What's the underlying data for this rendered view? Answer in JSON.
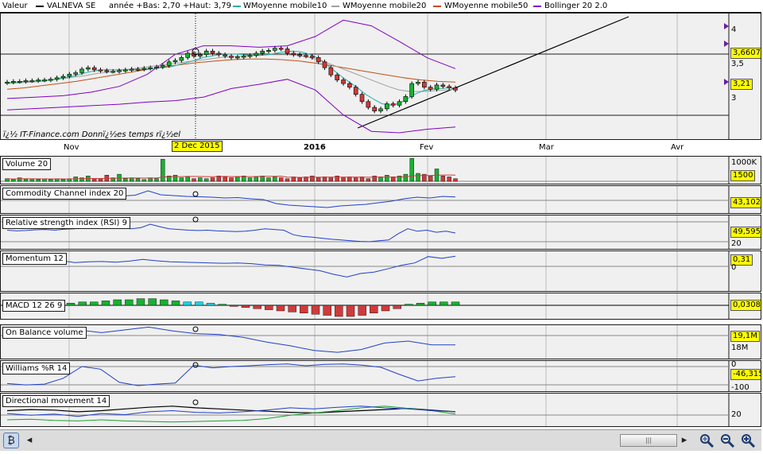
{
  "legend": {
    "valeur_label": "Valeur",
    "stock_name": "VALNEVA SE",
    "range_text": "année +Bas: 2,70 +Haut: 3,79",
    "ma10_label": "WMoyenne mobile10",
    "ma20_label": "WMoyenne mobile20",
    "ma50_label": "WMoyenne mobile50",
    "bollinger_label": "Bollinger 20 2.0",
    "colors": {
      "stock": "#000000",
      "ma10": "#20b2aa",
      "ma20": "#a0a0a0",
      "ma50": "#c0501a",
      "bollinger": "#8000c0"
    }
  },
  "main_chart": {
    "watermark": "ï¿½ IT-Finance.com  Donnï¿½es temps rï¿½el",
    "price_ticks": [
      "4",
      "3,5",
      "3"
    ],
    "last_price_box": "3,6607",
    "current_box": "3,21",
    "colors": {
      "up": "#19b032",
      "down": "#d03a3a",
      "ma10": "#20b2aa",
      "ma20": "#a0a0a0",
      "ma50": "#c0501a",
      "bollinger": "#8000c0"
    }
  },
  "time_axis": {
    "labels": [
      "Nov",
      "2016",
      "Fev",
      "Mar",
      "Avr"
    ],
    "cursor_date": "2 Dec 2015"
  },
  "indicators": {
    "volume": {
      "label": "Volume 20",
      "tick": "1000K",
      "value": "1500"
    },
    "cci": {
      "label": "Commodity Channel index 20",
      "value": "43,1022"
    },
    "rsi": {
      "label": "Relative strength index (RSI) 9",
      "value": "49,595",
      "tick": "20"
    },
    "momentum": {
      "label": "Momentum 12",
      "value": "0,31",
      "tick": "0"
    },
    "macd": {
      "label": "MACD 12 26 9",
      "value": "0,0308"
    },
    "obv": {
      "label": "On Balance volume",
      "value": "19,1M",
      "tick": "18M"
    },
    "williams": {
      "label": "Williams %R 14",
      "tick_top": "0",
      "value": "-46,315",
      "tick_bottom": "-100"
    },
    "dmi": {
      "label": "Directional movement 14",
      "tick": "20"
    }
  },
  "chart_data": {
    "type": "line",
    "title": "",
    "series": [
      {
        "name": "VALNEVA SE",
        "values": [
          3.32,
          3.33,
          3.33,
          3.34,
          3.34,
          3.35,
          3.35,
          3.36,
          3.38,
          3.4,
          3.43,
          3.45,
          3.5,
          3.52,
          3.49,
          3.48,
          3.47,
          3.47,
          3.48,
          3.49,
          3.5,
          3.5,
          3.51,
          3.52,
          3.53,
          3.55,
          3.6,
          3.62,
          3.66,
          3.72,
          3.68,
          3.7,
          3.75,
          3.72,
          3.7,
          3.68,
          3.66,
          3.67,
          3.68,
          3.69,
          3.72,
          3.75,
          3.76,
          3.79,
          3.78,
          3.72,
          3.7,
          3.69,
          3.68,
          3.66,
          3.6,
          3.52,
          3.42,
          3.35,
          3.3,
          3.25,
          3.15,
          3.05,
          2.97,
          2.92,
          2.95,
          3.02,
          3.0,
          3.05,
          3.12,
          3.3,
          3.32,
          3.25,
          3.22,
          3.28,
          3.26,
          3.24,
          3.21
        ]
      },
      {
        "name": "WMoyenne mobile10",
        "values": [
          3.31,
          3.32,
          3.33,
          3.33,
          3.34,
          3.35,
          3.36,
          3.38,
          3.4,
          3.43,
          3.46,
          3.48,
          3.49,
          3.49,
          3.49,
          3.49,
          3.49,
          3.5,
          3.51,
          3.52,
          3.53,
          3.56,
          3.59,
          3.62,
          3.66,
          3.68,
          3.7,
          3.71,
          3.71,
          3.7,
          3.69,
          3.69,
          3.7,
          3.72,
          3.74,
          3.75,
          3.74,
          3.71,
          3.66,
          3.58,
          3.49,
          3.4,
          3.32,
          3.24,
          3.15,
          3.08,
          3.02,
          3.0,
          3.02,
          3.08,
          3.15,
          3.2,
          3.22,
          3.23,
          3.24,
          3.24
        ]
      },
      {
        "name": "WMoyenne mobile20",
        "values": [
          3.3,
          3.31,
          3.32,
          3.33,
          3.35,
          3.37,
          3.39,
          3.41,
          3.44,
          3.46,
          3.48,
          3.5,
          3.52,
          3.54,
          3.56,
          3.58,
          3.6,
          3.62,
          3.64,
          3.66,
          3.67,
          3.68,
          3.69,
          3.7,
          3.7,
          3.7,
          3.69,
          3.66,
          3.62,
          3.56,
          3.5,
          3.44,
          3.38,
          3.32,
          3.26,
          3.21,
          3.19,
          3.19,
          3.2,
          3.21,
          3.22
        ]
      },
      {
        "name": "WMoyenne mobile50",
        "values": [
          3.22,
          3.24,
          3.27,
          3.3,
          3.33,
          3.37,
          3.41,
          3.45,
          3.49,
          3.53,
          3.56,
          3.59,
          3.61,
          3.63,
          3.64,
          3.64,
          3.63,
          3.61,
          3.58,
          3.54,
          3.5,
          3.46,
          3.42,
          3.38,
          3.35,
          3.33,
          3.32
        ]
      },
      {
        "name": "Bollinger 20 2.0",
        "values": [
          3.18,
          3.2,
          3.22,
          3.27,
          3.35,
          3.52,
          3.8,
          3.92,
          3.92,
          3.9,
          3.92,
          4.05,
          4.28,
          4.2,
          3.98,
          3.75,
          3.6
        ]
      },
      {
        "name": "Volume 20",
        "values": [
          0.3,
          0.2,
          0.4,
          0.2,
          0.3,
          0.2,
          0.3,
          0.2,
          0.3,
          0.2,
          0.3,
          0.5,
          0.4,
          0.6,
          0.3,
          0.3,
          0.7,
          0.4,
          0.8,
          0.3,
          0.4,
          0.3,
          0.2,
          0.4,
          0.3,
          2.5,
          0.6,
          0.7,
          0.4,
          0.5,
          0.3,
          0.4,
          0.3,
          0.4,
          0.6,
          0.5,
          0.4,
          0.5,
          0.6,
          0.4,
          0.5,
          0.6,
          0.4,
          0.5,
          0.4,
          0.3,
          0.5,
          0.4,
          0.5,
          0.6,
          0.4,
          0.5,
          0.4,
          0.6,
          0.4,
          0.5,
          0.4,
          0.5,
          0.3,
          0.6,
          0.5,
          0.7,
          0.5,
          0.6,
          0.8,
          2.6,
          0.9,
          0.8,
          0.6,
          1.4,
          0.6,
          0.5,
          0.3
        ]
      },
      {
        "name": "Relative strength index (RSI) 9",
        "values": [
          58,
          56,
          57,
          59,
          60,
          58,
          61,
          62,
          64,
          65,
          63,
          66,
          64,
          62,
          65,
          75,
          68,
          62,
          60,
          58,
          57,
          58,
          56,
          55,
          54,
          55,
          58,
          62,
          60,
          58,
          45,
          40,
          38,
          35,
          32,
          30,
          28,
          26,
          25,
          28,
          30,
          48,
          62,
          55,
          58,
          52,
          55,
          50
        ]
      },
      {
        "name": "Momentum 12",
        "values": [
          0.15,
          0.17,
          0.12,
          0.14,
          0.18,
          0.13,
          0.15,
          0.16,
          0.14,
          0.17,
          0.22,
          0.18,
          0.15,
          0.14,
          0.13,
          0.12,
          0.11,
          0.12,
          0.1,
          0.06,
          0.05,
          0.0,
          -0.05,
          -0.1,
          -0.2,
          -0.28,
          -0.18,
          -0.14,
          -0.05,
          0.05,
          0.12,
          0.3,
          0.25,
          0.31
        ]
      },
      {
        "name": "MACD 12 26 9",
        "values": [
          0.02,
          0.03,
          0.03,
          0.04,
          0.05,
          0.05,
          0.06,
          0.06,
          0.05,
          0.04,
          0.03,
          0.03,
          0.02,
          0.01,
          -0.01,
          -0.02,
          -0.03,
          -0.04,
          -0.05,
          -0.06,
          -0.07,
          -0.08,
          -0.09,
          -0.1,
          -0.1,
          -0.09,
          -0.07,
          -0.05,
          -0.03,
          0.01,
          0.02,
          0.03,
          0.03,
          0.03
        ]
      },
      {
        "name": "On Balance volume",
        "values": [
          20.6,
          20.5,
          20.7,
          20.7,
          20.4,
          20.7,
          21.0,
          20.6,
          20.3,
          20.2,
          19.9,
          19.4,
          19.0,
          18.5,
          18.3,
          18.6,
          19.3,
          19.5,
          19.1,
          19.1
        ]
      },
      {
        "name": "Williams %R 14",
        "values": [
          -20,
          -15,
          -18,
          -40,
          -85,
          -75,
          -25,
          -12,
          -18,
          -22,
          -90,
          -80,
          -85,
          -88,
          -92,
          -95,
          -88,
          -93,
          -95,
          -90,
          -82,
          -55,
          -30,
          -40,
          -46
        ]
      },
      {
        "name": "Directional movement 14",
        "values": [
          25,
          22,
          24,
          20,
          25,
          23,
          28,
          30,
          27,
          26,
          28,
          31,
          35,
          33,
          36,
          38,
          35,
          33,
          30,
          28
        ]
      }
    ]
  }
}
